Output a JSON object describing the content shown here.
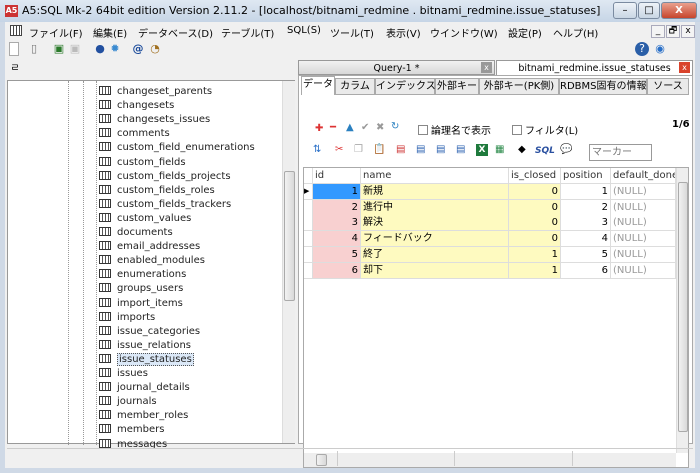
{
  "window": {
    "title": "A5:SQL Mk-2 64bit edition Version 2.11.2 - [localhost/bitnami_redmine . bitnami_redmine.issue_statuses]",
    "app_icon": "A5",
    "minimize": "–",
    "maximize": "□",
    "close": "X"
  },
  "menu": [
    "ファイル(F)",
    "編集(E)",
    "データベース(D)",
    "テーブル(T)",
    "SQL(S)",
    "ツール(T)",
    "表示(V)",
    "ウインドウ(W)",
    "設定(P)",
    "ヘルプ(H)"
  ],
  "mdi_buttons": {
    "minimize": "_",
    "restore": "🗗",
    "close": "x"
  },
  "toolbar_icons": [
    "new-file-icon",
    "open-icon",
    "connect-icon",
    "disconnect-icon",
    "database-icon",
    "settings-icon",
    "at-icon",
    "history-icon",
    "help-icon",
    "web-icon"
  ],
  "tree": {
    "items": [
      "changeset_parents",
      "changesets",
      "changesets_issues",
      "comments",
      "custom_field_enumerations",
      "custom_fields",
      "custom_fields_projects",
      "custom_fields_roles",
      "custom_fields_trackers",
      "custom_values",
      "documents",
      "email_addresses",
      "enabled_modules",
      "enumerations",
      "groups_users",
      "import_items",
      "imports",
      "issue_categories",
      "issue_relations",
      "issue_statuses",
      "issues",
      "journal_details",
      "journals",
      "member_roles",
      "members",
      "messages"
    ],
    "selected": "issue_statuses"
  },
  "doc_tabs": [
    {
      "label": "Query-1 *",
      "active": false
    },
    {
      "label": "bitnami_redmine.issue_statuses",
      "active": true
    }
  ],
  "sub_tabs": [
    "データ",
    "カラム",
    "インデックス",
    "外部キー",
    "外部キー(PK側)",
    "RDBMS固有の情報",
    "ソース"
  ],
  "data_toolbar": {
    "logical_name_label": "論理名で表示",
    "filter_label": "フィルタ(L)",
    "record_pos": "1/6",
    "marker_placeholder": "マーカー",
    "sql_label": "SQL"
  },
  "grid": {
    "columns": [
      "id",
      "name",
      "is_closed",
      "position",
      "default_done_r"
    ],
    "rows": [
      [
        "1",
        "新規",
        "0",
        "1",
        "(NULL)"
      ],
      [
        "2",
        "進行中",
        "0",
        "2",
        "(NULL)"
      ],
      [
        "3",
        "解決",
        "0",
        "3",
        "(NULL)"
      ],
      [
        "4",
        "フィードバック",
        "0",
        "4",
        "(NULL)"
      ],
      [
        "5",
        "終了",
        "1",
        "5",
        "(NULL)"
      ],
      [
        "6",
        "却下",
        "1",
        "6",
        "(NULL)"
      ]
    ]
  },
  "colors": {
    "pk_cell": "#f8d0d0",
    "selected_cell": "#3399ff",
    "name_cell": "#fefac0",
    "null_text": "#999999"
  }
}
